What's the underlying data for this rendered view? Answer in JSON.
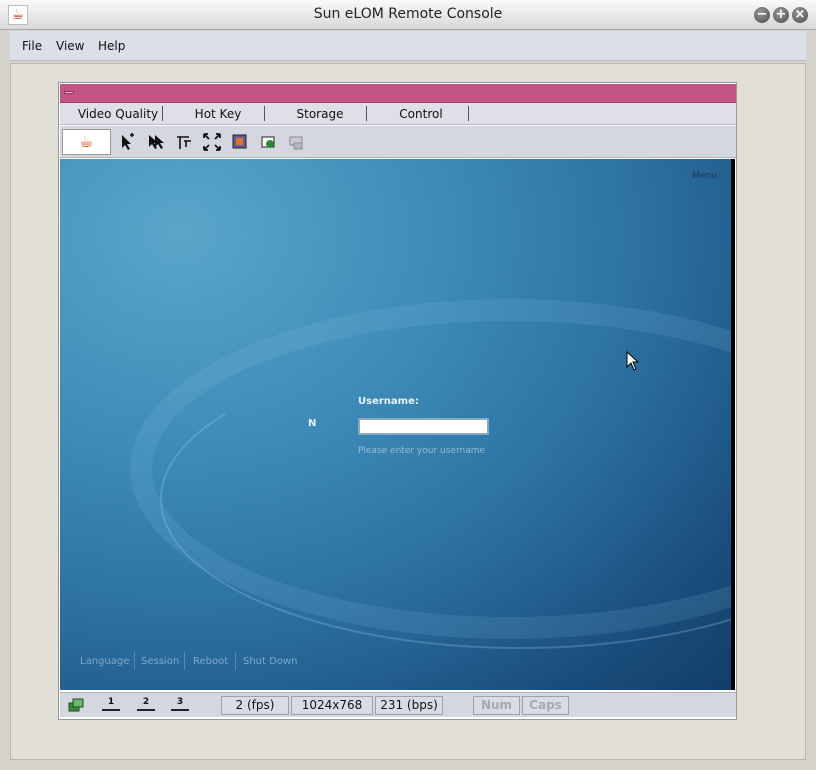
{
  "window": {
    "title": "Sun eLOM Remote Console",
    "app_icon": "java-icon"
  },
  "menubar": {
    "items": [
      "File",
      "View",
      "Help"
    ]
  },
  "console_menu": {
    "items": [
      "Video Quality",
      "Hot Key",
      "Storage",
      "Control"
    ]
  },
  "toolbar": {
    "icons": [
      "java-logo-icon",
      "mouse-mode-icon",
      "mouse-sync-icon",
      "cursor-alt-icon",
      "fullscreen-icon",
      "screenshot-icon",
      "capture-icon",
      "disconnect-icon"
    ]
  },
  "remote_screen": {
    "menu_label": "Menu",
    "prompt_prefix": "N",
    "username_label": "Username:",
    "username_value": "",
    "hint": "Please enter your username",
    "bottom_links": [
      "Language",
      "Session",
      "Reboot",
      "Shut Down"
    ]
  },
  "statusbar": {
    "desktops": [
      "1",
      "2",
      "3"
    ],
    "fps": "2 (fps)",
    "resolution": "1024x768",
    "bandwidth": "231 (bps)",
    "num": "Num",
    "caps": "Caps"
  },
  "colors": {
    "inner_title": "#c25584",
    "screen_dark": "#123e69",
    "screen_light": "#5aa6ca"
  }
}
